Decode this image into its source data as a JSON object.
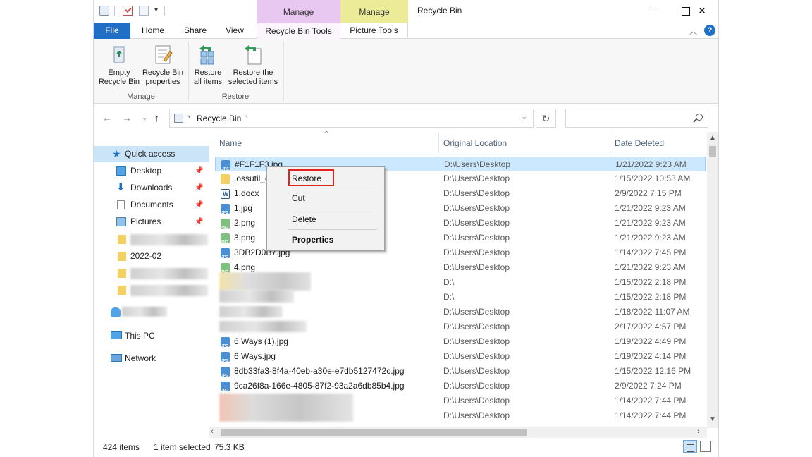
{
  "window": {
    "title": "Recycle Bin",
    "context_groups": [
      "Manage",
      "Manage"
    ]
  },
  "tabs": {
    "file": "File",
    "home": "Home",
    "share": "Share",
    "view": "View",
    "recycle_bin_tools": "Recycle Bin Tools",
    "picture_tools": "Picture Tools"
  },
  "ribbon": {
    "empty_recycle_bin": "Empty\nRecycle Bin",
    "recycle_bin_properties": "Recycle Bin\nproperties",
    "restore_all_items": "Restore\nall items",
    "restore_selected_items": "Restore the\nselected items",
    "group_manage": "Manage",
    "group_restore": "Restore"
  },
  "address": {
    "path": "Recycle Bin"
  },
  "nav_pane": {
    "quick_access": "Quick access",
    "items": [
      {
        "label": "Desktop",
        "pinned": true
      },
      {
        "label": "Downloads",
        "pinned": true
      },
      {
        "label": "Documents",
        "pinned": true
      },
      {
        "label": "Pictures",
        "pinned": true
      },
      {
        "label": "2022-02",
        "pinned": false
      }
    ],
    "this_pc": "This PC",
    "network": "Network"
  },
  "columns": {
    "name": "Name",
    "original_location": "Original Location",
    "date_deleted": "Date Deleted"
  },
  "files": [
    {
      "name": "#F1F1F3.jpg",
      "type": "jpg",
      "location": "D:\\Users\\Desktop",
      "date": "1/21/2022 9:23 AM",
      "selected": true
    },
    {
      "name": ".ossutil_c",
      "type": "folder",
      "location": "D:\\Users\\Desktop",
      "date": "1/15/2022 10:53 AM"
    },
    {
      "name": "1.docx",
      "type": "docx",
      "location": "D:\\Users\\Desktop",
      "date": "2/9/2022 7:15 PM"
    },
    {
      "name": "1.jpg",
      "type": "jpg",
      "location": "D:\\Users\\Desktop",
      "date": "1/21/2022 9:23 AM"
    },
    {
      "name": "2.png",
      "type": "png",
      "location": "D:\\Users\\Desktop",
      "date": "1/21/2022 9:23 AM"
    },
    {
      "name": "3.png",
      "type": "png",
      "location": "D:\\Users\\Desktop",
      "date": "1/21/2022 9:23 AM"
    },
    {
      "name": "3DB2D0B7.jpg",
      "type": "jpg",
      "location": "D:\\Users\\Desktop",
      "date": "1/14/2022 7:45 PM"
    },
    {
      "name": "4.png",
      "type": "png",
      "location": "D:\\Users\\Desktop",
      "date": "1/21/2022 9:23 AM"
    },
    {
      "name": "",
      "type": "blurred",
      "location": "D:\\",
      "date": "1/15/2022 2:18 PM"
    },
    {
      "name": "",
      "type": "blurred",
      "location": "D:\\",
      "date": "1/15/2022 2:18 PM"
    },
    {
      "name": "",
      "type": "blurred",
      "location": "D:\\Users\\Desktop",
      "date": "1/18/2022 11:07 AM"
    },
    {
      "name": "",
      "type": "blurred",
      "location": "D:\\Users\\Desktop",
      "date": "2/17/2022 4:57 PM"
    },
    {
      "name": "6 Ways (1).jpg",
      "type": "jpg",
      "location": "D:\\Users\\Desktop",
      "date": "1/19/2022 4:49 PM"
    },
    {
      "name": "6 Ways.jpg",
      "type": "jpg",
      "location": "D:\\Users\\Desktop",
      "date": "1/19/2022 4:14 PM"
    },
    {
      "name": "8db33fa3-8f4a-40eb-a30e-e7db5127472c.jpg",
      "type": "jpg",
      "location": "D:\\Users\\Desktop",
      "date": "1/15/2022 12:16 PM"
    },
    {
      "name": "9ca26f8a-166e-4805-87f2-93a2a6db85b4.jpg",
      "type": "jpg",
      "location": "D:\\Users\\Desktop",
      "date": "2/9/2022 7:24 PM"
    },
    {
      "name": "",
      "type": "blurred",
      "location": "D:\\Users\\Desktop",
      "date": "1/14/2022 7:44 PM"
    },
    {
      "name": "",
      "type": "blurred",
      "location": "D:\\Users\\Desktop",
      "date": "1/14/2022 7:44 PM"
    }
  ],
  "context_menu": {
    "restore": "Restore",
    "cut": "Cut",
    "delete": "Delete",
    "properties": "Properties"
  },
  "status": {
    "count": "424 items",
    "selected": "1 item selected",
    "size": "75.3 KB"
  },
  "colors": {
    "file_tab": "#1f6fc7",
    "manage_recycle": "#e8c7f0",
    "manage_picture": "#ecec98",
    "selection": "#cce8ff",
    "highlight_box": "#e0241f"
  }
}
